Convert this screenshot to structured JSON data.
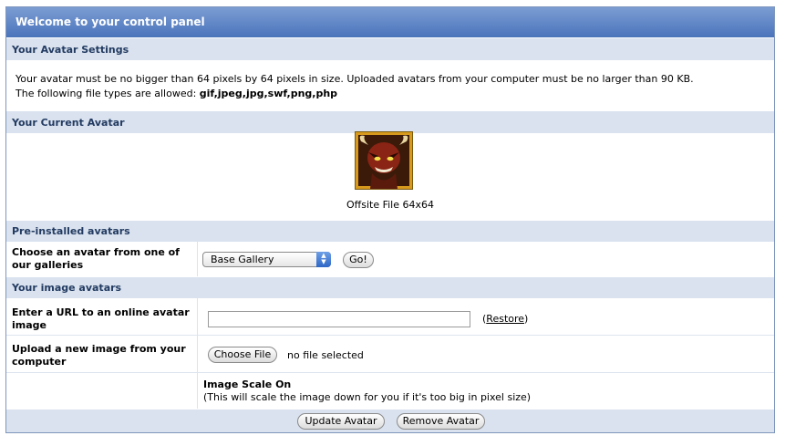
{
  "title": "Welcome to your control panel",
  "sections": {
    "avatar_settings": "Your Avatar Settings",
    "current_avatar": "Your Current Avatar",
    "preinstalled": "Pre-installed avatars",
    "image_avatars": "Your image avatars"
  },
  "settings_text": {
    "line1": "Your avatar must be no bigger than 64 pixels by 64 pixels in size. Uploaded avatars from your computer must be no larger than 90 KB.",
    "line2_prefix": "The following file types are allowed: ",
    "file_types": "gif,jpeg,jpg,swf,png,php"
  },
  "current_avatar": {
    "caption": "Offsite File 64x64"
  },
  "gallery": {
    "label_line1": "Choose an avatar from one of",
    "label_line2": "our galleries",
    "selected": "Base Gallery",
    "go_button": "Go!"
  },
  "url_field": {
    "label_line1": "Enter a URL to an online avatar",
    "label_line2": "image",
    "value": "",
    "restore_open": "(",
    "restore_link": "Restore",
    "restore_close": ")"
  },
  "upload": {
    "label_line1": "Upload a new image from your",
    "label_line2": "computer",
    "choose_button": "Choose File",
    "status": "no file selected"
  },
  "scale": {
    "title": "Image Scale On",
    "note": "(This will scale the image down for you if it's too big in pixel size)"
  },
  "actions": {
    "update": "Update Avatar",
    "remove": "Remove Avatar"
  }
}
